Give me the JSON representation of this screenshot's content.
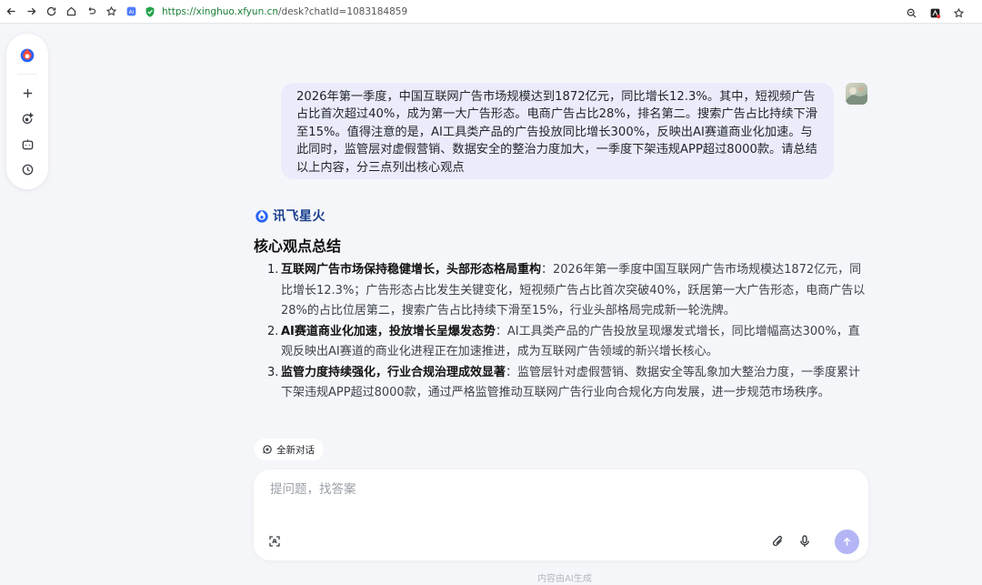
{
  "browser": {
    "url_secure": "https://",
    "url_host": "xinghuo.xfyun.cn",
    "url_path": "/desk?chatId=1083184859"
  },
  "rail": {
    "items": [
      "new-chat",
      "agent",
      "bot",
      "history"
    ]
  },
  "user_message": "2026年第一季度，中国互联网广告市场规模达到1872亿元，同比增长12.3%。其中，短视频广告占比首次超过40%，成为第一大广告形态。电商广告占比28%，排名第二。搜索广告占比持续下滑至15%。值得注意的是，AI工具类产品的广告投放同比增长300%，反映出AI赛道商业化加速。与此同时，监管层对虚假营销、数据安全的整治力度加大，一季度下架违规APP超过8000款。请总结以上内容，分三点列出核心观点",
  "bot": {
    "name": "讯飞星火"
  },
  "answer": {
    "title": "核心观点总结",
    "items": [
      {
        "num": "1.",
        "head": "互联网广告市场保持稳健增长，头部形态格局重构",
        "body": "：2026年第一季度中国互联网广告市场规模达1872亿元，同比增长12.3%；广告形态占比发生关键变化，短视频广告占比首次突破40%，跃居第一大广告形态，电商广告以28%的占比位居第二，搜索广告占比持续下滑至15%，行业头部格局完成新一轮洗牌。"
      },
      {
        "num": "2.",
        "head": "AI赛道商业化加速，投放增长呈爆发态势",
        "body": "：AI工具类产品的广告投放呈现爆发式增长，同比增幅高达300%，直观反映出AI赛道的商业化进程正在加速推进，成为互联网广告领域的新兴增长核心。"
      },
      {
        "num": "3.",
        "head": "监管力度持续强化，行业合规治理成效显著",
        "body": "：监管层针对虚假营销、数据安全等乱象加大整治力度，一季度累计下架违规APP超过8000款，通过严格监管推动互联网广告行业向合规化方向发展，进一步规范市场秩序。"
      }
    ]
  },
  "new_chat_label": "全新对话",
  "composer": {
    "placeholder": "提问题，找答案"
  },
  "footer_note": "内容由AI生成",
  "colors": {
    "accent": "#b3b5f5",
    "user_bubble": "#ebecfb",
    "brand_blue": "#1a3f8f"
  }
}
